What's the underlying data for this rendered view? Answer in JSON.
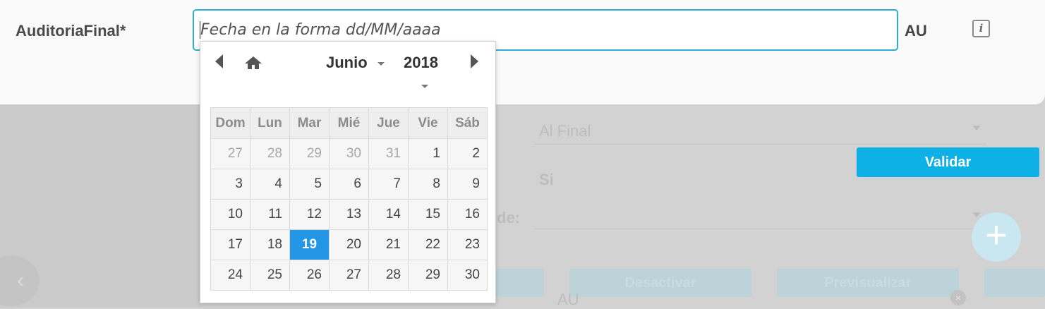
{
  "form": {
    "field_label": "AuditoriaFinal*",
    "date_input_value": "",
    "date_input_placeholder": "Fecha en la forma dd/MM/aaaa",
    "unit_label": "AU",
    "info_icon": "info-icon",
    "info_icon_glyph": "i"
  },
  "calendar": {
    "month": "Junio",
    "year": "2018",
    "weekday_headers": [
      "Dom",
      "Lun",
      "Mar",
      "Mié",
      "Jue",
      "Vie",
      "Sáb"
    ],
    "weeks": [
      [
        {
          "day": "27",
          "other": true
        },
        {
          "day": "28",
          "other": true
        },
        {
          "day": "29",
          "other": true
        },
        {
          "day": "30",
          "other": true
        },
        {
          "day": "31",
          "other": true
        },
        {
          "day": "1"
        },
        {
          "day": "2"
        }
      ],
      [
        {
          "day": "3"
        },
        {
          "day": "4"
        },
        {
          "day": "5"
        },
        {
          "day": "6"
        },
        {
          "day": "7"
        },
        {
          "day": "8"
        },
        {
          "day": "9"
        }
      ],
      [
        {
          "day": "10"
        },
        {
          "day": "11"
        },
        {
          "day": "12"
        },
        {
          "day": "13"
        },
        {
          "day": "14"
        },
        {
          "day": "15"
        },
        {
          "day": "16"
        }
      ],
      [
        {
          "day": "17"
        },
        {
          "day": "18"
        },
        {
          "day": "19",
          "selected": true
        },
        {
          "day": "20"
        },
        {
          "day": "21"
        },
        {
          "day": "22"
        },
        {
          "day": "23"
        }
      ],
      [
        {
          "day": "24"
        },
        {
          "day": "25"
        },
        {
          "day": "26"
        },
        {
          "day": "27"
        },
        {
          "day": "28"
        },
        {
          "day": "29"
        },
        {
          "day": "30"
        }
      ]
    ],
    "selected_color": "#2496e6"
  },
  "background": {
    "dropdown_value": "Al Final",
    "yes_value": "Si",
    "partial_label": "de:",
    "validate_button": "Validar",
    "deactivate_button": "Desactivar",
    "preview_button": "Previsualizar",
    "chip_text": "AU",
    "chip_close": "×",
    "add_button_glyph": "+",
    "nav_left_glyph": "‹",
    "accent_color": "#0db1e6"
  }
}
